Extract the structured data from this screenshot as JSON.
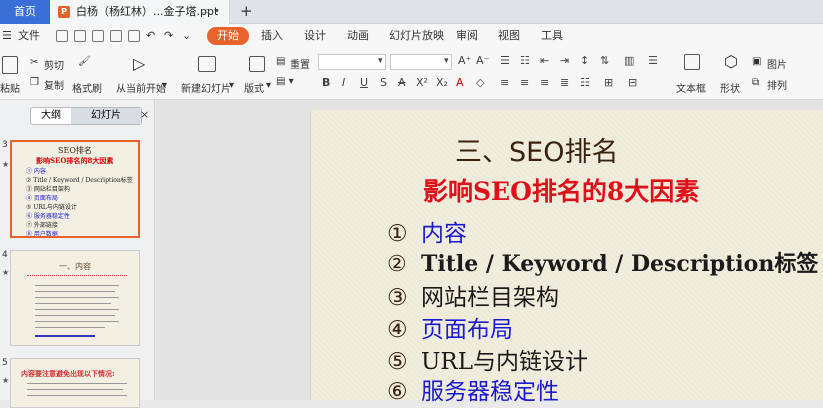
{
  "tabs": {
    "home": "首页",
    "doc": "白杨（杨红林）...金子塔.ppt",
    "add": "+"
  },
  "menu": {
    "file": "文件",
    "items": [
      "开始",
      "插入",
      "设计",
      "动画",
      "幻灯片放映",
      "审阅",
      "视图",
      "工具"
    ]
  },
  "ribbon": {
    "paste": "粘贴",
    "cut": "剪切",
    "copy": "复制",
    "format_painter": "格式刷",
    "play_from_current": "从当前开始",
    "new_slide": "新建幻灯片",
    "layout": "版式",
    "reset": "重置",
    "textbox": "文本框",
    "shape": "形状",
    "picture": "图片",
    "arrange": "排列"
  },
  "pane": {
    "tab_outline": "大纲",
    "tab_slides": "幻灯片",
    "close": "×",
    "slides": [
      {
        "num": "3",
        "title": "SEO排名",
        "sub": "影响SEO排名的8大因素",
        "items": [
          "内容",
          "Title / Keyword / Description标签",
          "网站栏目架构",
          "页面布局",
          "URL与内链设计",
          "服务器稳定性",
          "外部链接",
          "用户数据"
        ]
      },
      {
        "num": "4",
        "title": "一、内容"
      },
      {
        "num": "5",
        "title": "内容要注意避免出现以下情况:"
      }
    ]
  },
  "slide": {
    "title": "三、SEO排名",
    "subtitle": "影响SEO排名的8大因素",
    "items": [
      {
        "n": "①",
        "text": "内容"
      },
      {
        "n": "②",
        "text": "Title / Keyword / Description标签"
      },
      {
        "n": "③",
        "text": "网站栏目架构"
      },
      {
        "n": "④",
        "text": "页面布局"
      },
      {
        "n": "⑤",
        "text": "URL与内链设计"
      },
      {
        "n": "⑥",
        "text": "服务器稳定性"
      }
    ]
  },
  "colors": {
    "accent": "#e8622d",
    "home_tab": "#3a6fd8",
    "subtitle_red": "#e0101a",
    "item_blue": "#1a1ad0"
  }
}
